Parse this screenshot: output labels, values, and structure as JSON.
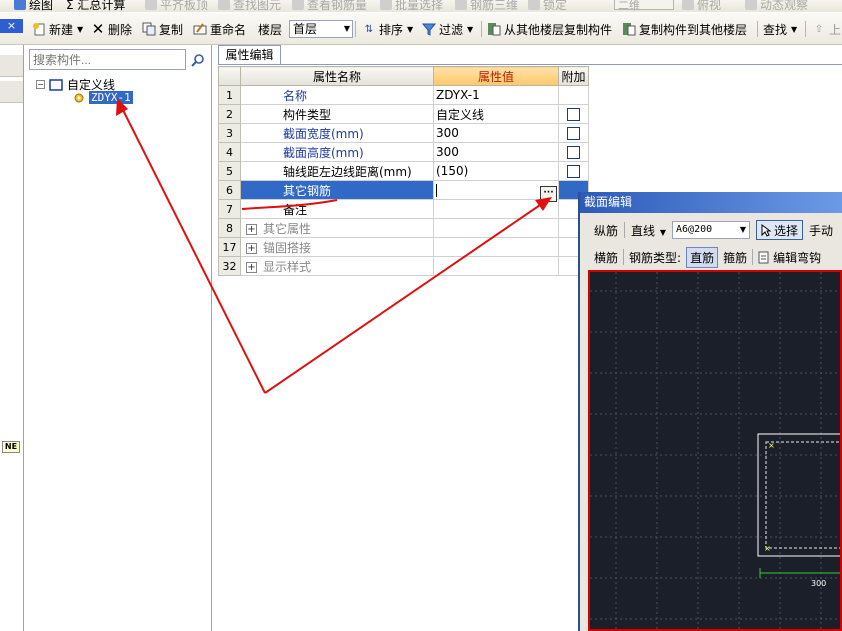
{
  "toolbar_top": {
    "items": [
      "绘图",
      "Σ 汇总计算",
      "平齐板顶",
      "查找图元",
      "查看钢筋量",
      "批量选择",
      "钢筋三维",
      "锁定"
    ],
    "view_combo": "二维",
    "look_label": "俯视",
    "dynamic_label": "动态观察"
  },
  "toolbar_main": {
    "close_label": "×",
    "new_label": "新建",
    "delete_label": "删除",
    "copy_label": "复制",
    "rename_label": "重命名",
    "floor_label": "楼层",
    "floor_value": "首层",
    "sort_label": "排序",
    "filter_label": "过滤",
    "copy_from_label": "从其他楼层复制构件",
    "copy_to_label": "复制构件到其他楼层",
    "find_label": "查找",
    "up_label": "上"
  },
  "tree": {
    "search_placeholder": "搜索构件...",
    "root_label": "自定义线",
    "child_label": "ZDYX-1"
  },
  "left_badge": "NE",
  "property_editor": {
    "tab_label": "属性编辑",
    "headers": {
      "name": "属性名称",
      "value": "属性值",
      "addon": "附加"
    },
    "rows": [
      {
        "num": "1",
        "name": "名称",
        "value": "ZDYX-1",
        "has_check": false,
        "style": "blue"
      },
      {
        "num": "2",
        "name": "构件类型",
        "value": "自定义线",
        "has_check": true,
        "style": "black"
      },
      {
        "num": "3",
        "name": "截面宽度(mm)",
        "value": "300",
        "has_check": true,
        "style": "blue"
      },
      {
        "num": "4",
        "name": "截面高度(mm)",
        "value": "300",
        "has_check": true,
        "style": "blue"
      },
      {
        "num": "5",
        "name": "轴线距左边线距离(mm)",
        "value": "(150)",
        "has_check": true,
        "style": "black"
      },
      {
        "num": "6",
        "name": "其它钢筋",
        "value": "",
        "has_check": false,
        "style": "selected"
      },
      {
        "num": "7",
        "name": "备注",
        "value": "",
        "has_check": false,
        "style": "black"
      },
      {
        "num": "8",
        "name": "其它属性",
        "value": "",
        "has_check": false,
        "style": "group"
      },
      {
        "num": "17",
        "name": "锚固搭接",
        "value": "",
        "has_check": false,
        "style": "group"
      },
      {
        "num": "32",
        "name": "显示样式",
        "value": "",
        "has_check": false,
        "style": "group"
      }
    ],
    "ellipsis_label": "···"
  },
  "section_editor": {
    "title": "截面编辑",
    "tb1": {
      "longitudinal": "纵筋",
      "line_mode": "直线",
      "rebar_spec": "A6@200",
      "select_label": "选择",
      "manual_label": "手动"
    },
    "tb2": {
      "transverse": "横筋",
      "rebar_type_label": "钢筋类型:",
      "straight": "直筋",
      "stirrup": "箍筋",
      "edit_hook": "编辑弯钩"
    },
    "dimension_label": "300"
  },
  "colors": {
    "selection": "#3169c6",
    "value_header": "#ffc86a",
    "annotation_red": "#e01010",
    "canvas_bg": "#1b1f2a"
  }
}
